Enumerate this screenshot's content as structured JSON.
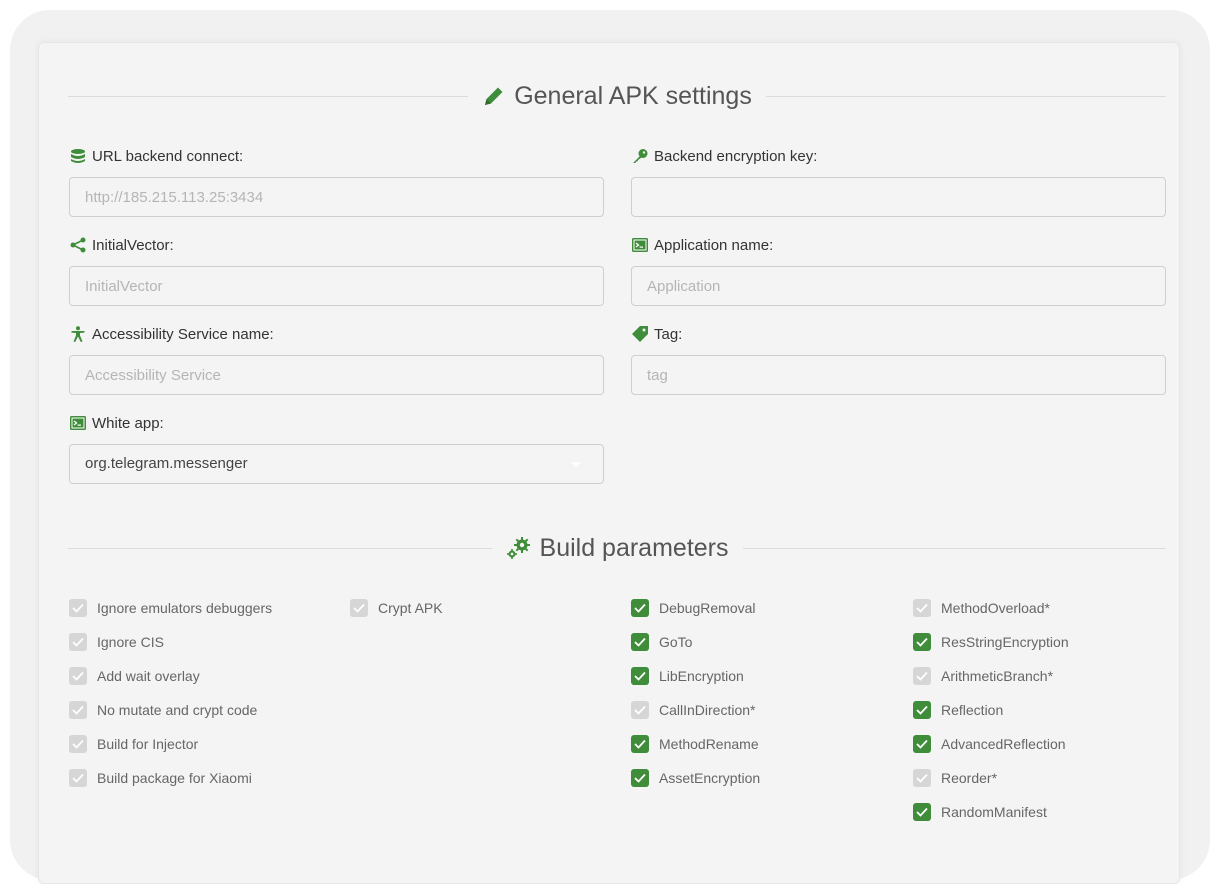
{
  "colors": {
    "accent": "#3f8d3a",
    "check_on": "#3f8d3a",
    "check_off": "#d6d6d6"
  },
  "general": {
    "title": "General APK settings",
    "title_icon": "pencil-icon",
    "fields": {
      "url": {
        "label": "URL backend connect:",
        "icon": "database-icon",
        "placeholder": "http://185.215.113.25:3434",
        "value": ""
      },
      "key": {
        "label": "Backend encryption key:",
        "icon": "key-icon",
        "placeholder": "",
        "value": ""
      },
      "vector": {
        "label": "InitialVector:",
        "icon": "share-icon",
        "placeholder": "InitialVector",
        "value": ""
      },
      "appname": {
        "label": "Application name:",
        "icon": "terminal-icon",
        "placeholder": "Application",
        "value": ""
      },
      "access": {
        "label": "Accessibility Service name:",
        "icon": "accessibility-icon",
        "placeholder": "Accessibility Service",
        "value": ""
      },
      "tag": {
        "label": "Tag:",
        "icon": "tag-icon",
        "placeholder": "tag",
        "value": ""
      },
      "white": {
        "label": "White app:",
        "icon": "terminal-icon",
        "selected": "org.telegram.messenger"
      }
    }
  },
  "build": {
    "title": "Build parameters",
    "title_icon": "gears-icon",
    "col1": [
      {
        "label": "Ignore emulators debuggers",
        "checked": false
      },
      {
        "label": "Ignore CIS",
        "checked": false
      },
      {
        "label": "Add wait overlay",
        "checked": false
      },
      {
        "label": "No mutate and crypt code",
        "checked": false
      },
      {
        "label": "Build for Injector",
        "checked": false
      },
      {
        "label": "Build package for Xiaomi",
        "checked": false
      }
    ],
    "col2": [
      {
        "label": "Crypt APK",
        "checked": false
      }
    ],
    "col3": [
      {
        "label": "DebugRemoval",
        "checked": true
      },
      {
        "label": "GoTo",
        "checked": true
      },
      {
        "label": "LibEncryption",
        "checked": true
      },
      {
        "label": "CallInDirection*",
        "checked": false
      },
      {
        "label": "MethodRename",
        "checked": true
      },
      {
        "label": "AssetEncryption",
        "checked": true
      }
    ],
    "col4": [
      {
        "label": "MethodOverload*",
        "checked": false
      },
      {
        "label": "ResStringEncryption",
        "checked": true
      },
      {
        "label": "ArithmeticBranch*",
        "checked": false
      },
      {
        "label": "Reflection",
        "checked": true
      },
      {
        "label": "AdvancedReflection",
        "checked": true
      },
      {
        "label": "Reorder*",
        "checked": false
      },
      {
        "label": "RandomManifest",
        "checked": true
      }
    ]
  }
}
